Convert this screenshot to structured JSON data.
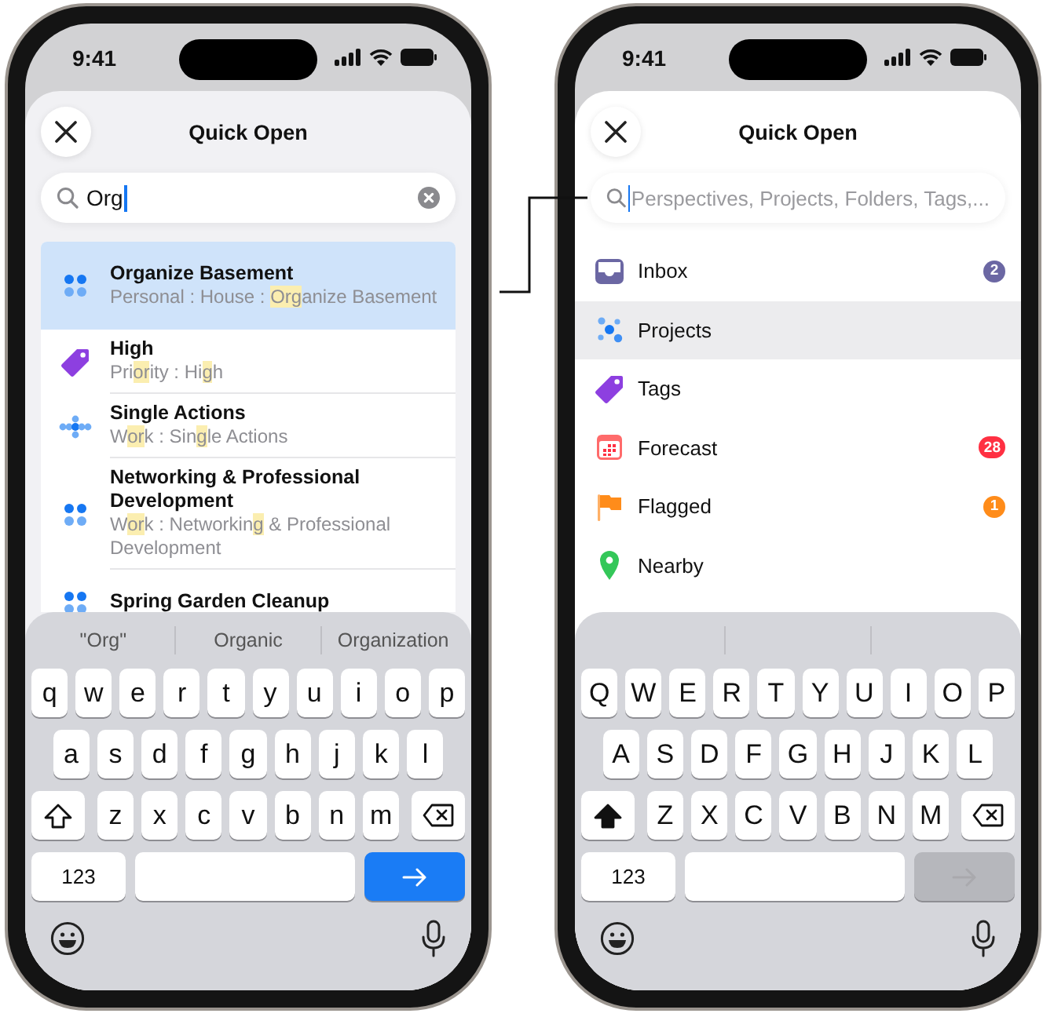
{
  "phones": [
    {
      "status_bar": {
        "time": "9:41"
      },
      "title": "Quick Open",
      "search": {
        "value": "Org"
      },
      "results": [
        {
          "kind": "project",
          "title": "Organize Basement",
          "selected": true,
          "subtitle": [
            {
              "text": "Personal : House : "
            },
            {
              "text": "Org",
              "highlighted": true
            },
            {
              "text": "anize Basement"
            }
          ]
        },
        {
          "kind": "tag",
          "title": "High",
          "selected": false,
          "subtitle": [
            {
              "text": "Pri"
            },
            {
              "text": "or",
              "highlighted": true
            },
            {
              "text": "ity : Hi"
            },
            {
              "text": "g",
              "highlighted": true
            },
            {
              "text": "h"
            }
          ]
        },
        {
          "kind": "single-actions",
          "title": "Single Actions",
          "selected": false,
          "subtitle": [
            {
              "text": "W"
            },
            {
              "text": "or",
              "highlighted": true
            },
            {
              "text": "k : Sin"
            },
            {
              "text": "g",
              "highlighted": true
            },
            {
              "text": "le Actions"
            }
          ]
        },
        {
          "kind": "project",
          "title": "Networking & Professional Development",
          "selected": false,
          "subtitle": [
            {
              "text": "W"
            },
            {
              "text": "or",
              "highlighted": true
            },
            {
              "text": "k : Networkin"
            },
            {
              "text": "g",
              "highlighted": true
            },
            {
              "text": " & Professional Development"
            }
          ]
        },
        {
          "kind": "project",
          "title": "Spring Garden Cleanup",
          "selected": false
        }
      ],
      "keyboard": {
        "suggestions": [
          "\"Org\"",
          "Organic",
          "Organization"
        ],
        "rows": [
          [
            "q",
            "w",
            "e",
            "r",
            "t",
            "y",
            "u",
            "i",
            "o",
            "p"
          ],
          [
            "a",
            "s",
            "d",
            "f",
            "g",
            "h",
            "j",
            "k",
            "l"
          ],
          [
            "z",
            "x",
            "c",
            "v",
            "b",
            "n",
            "m"
          ]
        ],
        "shift": false,
        "numbers_key": "123",
        "return_enabled": true
      }
    },
    {
      "status_bar": {
        "time": "9:41"
      },
      "title": "Quick Open",
      "search": {
        "placeholder": "Perspectives, Projects, Folders, Tags,..."
      },
      "items": [
        {
          "kind": "inbox",
          "label": "Inbox",
          "selected": false,
          "badge": "2",
          "color": "#6b67a3"
        },
        {
          "kind": "projects",
          "label": "Projects",
          "selected": true
        },
        {
          "kind": "tags",
          "label": "Tags",
          "selected": false
        },
        {
          "kind": "forecast",
          "label": "Forecast",
          "selected": false,
          "badge": "28",
          "color": "#ff3042"
        },
        {
          "kind": "flagged",
          "label": "Flagged",
          "selected": false,
          "badge": "1",
          "color": "#ff8c1a"
        },
        {
          "kind": "nearby",
          "label": "Nearby",
          "selected": false
        }
      ],
      "keyboard": {
        "rows": [
          [
            "Q",
            "W",
            "E",
            "R",
            "T",
            "Y",
            "U",
            "I",
            "O",
            "P"
          ],
          [
            "A",
            "S",
            "D",
            "F",
            "G",
            "H",
            "J",
            "K",
            "L"
          ],
          [
            "Z",
            "X",
            "C",
            "V",
            "B",
            "N",
            "M"
          ]
        ],
        "shift": true,
        "numbers_key": "123",
        "return_enabled": false
      }
    }
  ]
}
